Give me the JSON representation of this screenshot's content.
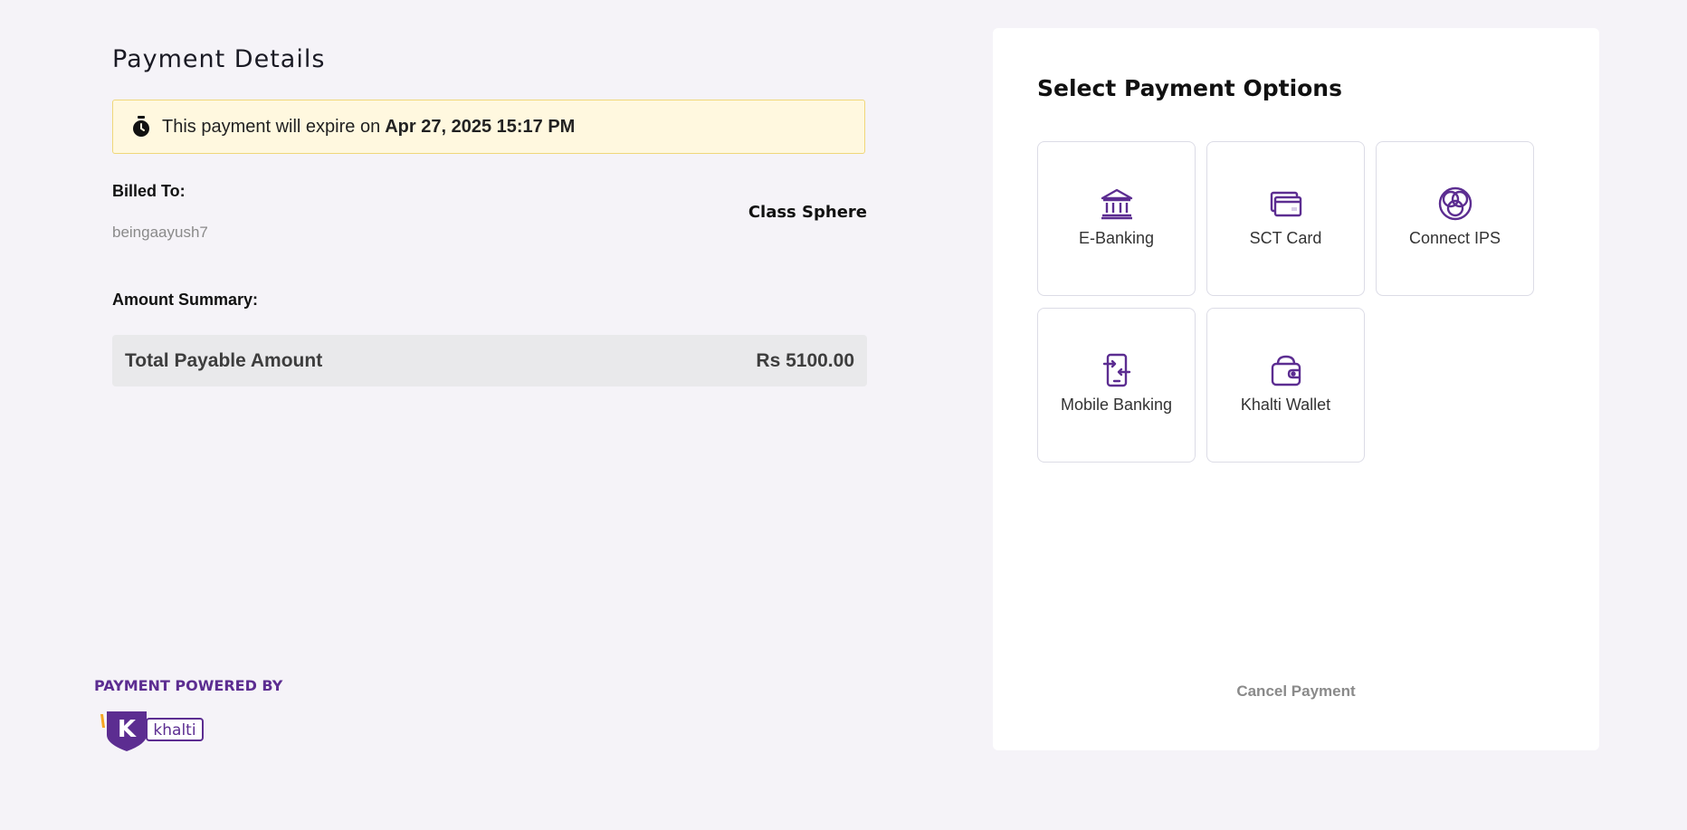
{
  "payment_details": {
    "title": "Payment Details",
    "expiry_prefix": "This payment will expire on",
    "expiry_date": "Apr 27, 2025 15:17 PM",
    "billed_to_label": "Billed To:",
    "billed_to_user": "beingaayush7",
    "merchant_name": "Class Sphere",
    "amount_summary_label": "Amount Summary:",
    "total_label": "Total Payable Amount",
    "total_value": "Rs 5100.00"
  },
  "powered_by": {
    "label": "PAYMENT POWERED BY",
    "logo_text": "khalti",
    "logo_letter": "K"
  },
  "payment_options": {
    "title": "Select Payment Options",
    "options": [
      {
        "label": "E-Banking",
        "icon": "bank-icon"
      },
      {
        "label": "SCT Card",
        "icon": "card-icon"
      },
      {
        "label": "Connect IPS",
        "icon": "connect-ips-icon"
      },
      {
        "label": "Mobile Banking",
        "icon": "mobile-banking-icon"
      },
      {
        "label": "Khalti Wallet",
        "icon": "wallet-icon"
      }
    ],
    "cancel_label": "Cancel Payment"
  },
  "colors": {
    "accent_purple": "#5c2d91",
    "expiry_bg": "#fff8df",
    "page_bg": "#f5f3f8"
  }
}
